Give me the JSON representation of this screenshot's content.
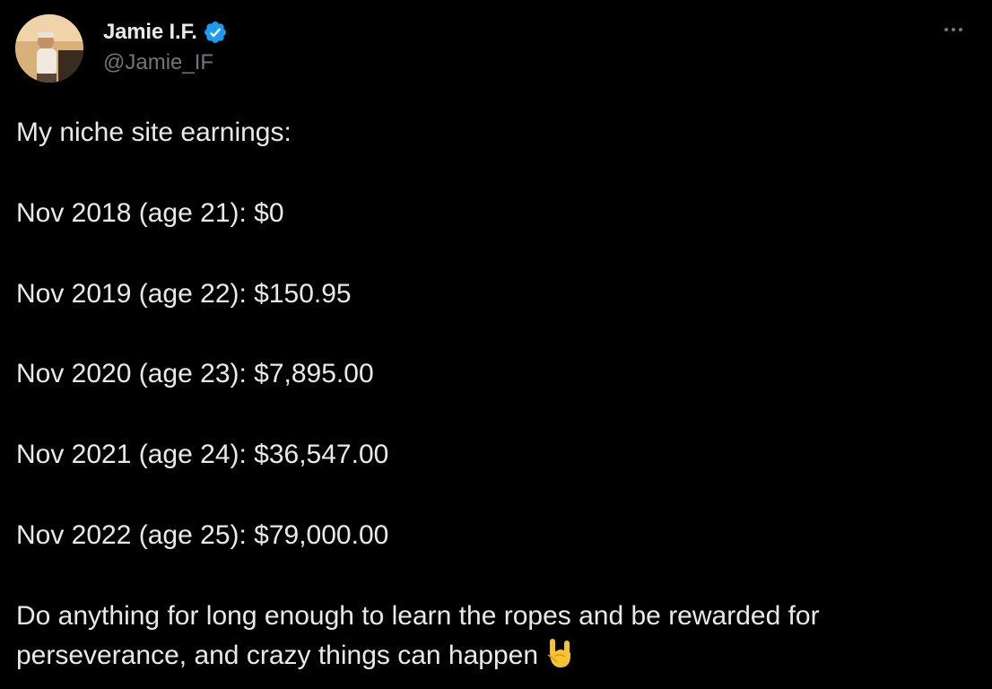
{
  "author": {
    "display_name": "Jamie I.F.",
    "handle": "@Jamie_IF",
    "verified": true,
    "verified_color": "#1d9bf0"
  },
  "tweet": {
    "lines": [
      "My niche site earnings:",
      "Nov 2018 (age 21): $0",
      "Nov 2019 (age 22): $150.95",
      "Nov 2020 (age 23): $7,895.00",
      "Nov 2021 (age 24): $36,547.00",
      "Nov 2022 (age 25): $79,000.00",
      "Do anything for long enough to learn the ropes and be rewarded for",
      "perseverance, and crazy things can happen"
    ],
    "emoji": "sign-of-the-horns"
  },
  "icons": {
    "more": "more-options-icon",
    "verified": "verified-badge-icon"
  },
  "colors": {
    "background": "#000000",
    "text": "#e7e9ea",
    "secondary_text": "#71767b"
  }
}
